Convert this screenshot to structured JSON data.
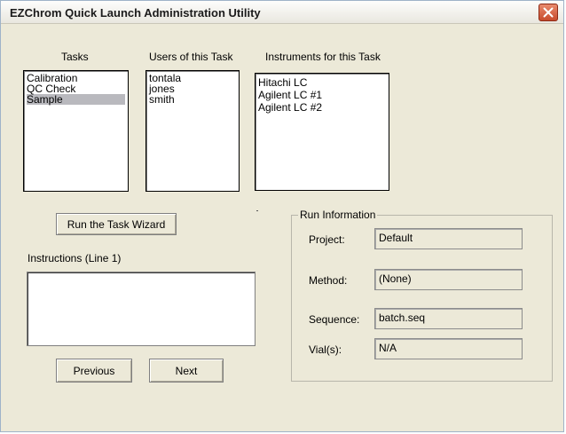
{
  "window": {
    "title": "EZChrom Quick Launch Administration Utility"
  },
  "tasks": {
    "header": "Tasks",
    "items": [
      "Calibration",
      "QC Check",
      "Sample"
    ],
    "selected_index": 2
  },
  "users": {
    "header": "Users of this Task",
    "items": [
      "tontala",
      "jones",
      "smith"
    ]
  },
  "instruments": {
    "header": "Instruments for this Task",
    "items": [
      "Hitachi LC",
      "Agilent LC #1",
      "Agilent LC #2"
    ]
  },
  "buttons": {
    "run_wizard": "Run the Task Wizard",
    "previous": "Previous",
    "next": "Next"
  },
  "instructions": {
    "label": "Instructions  (Line 1)",
    "value": ""
  },
  "run_info": {
    "legend": "Run Information",
    "project_label": "Project:",
    "project_value": "Default",
    "method_label": "Method:",
    "method_value": "(None)",
    "sequence_label": "Sequence:",
    "sequence_value": "batch.seq",
    "vials_label": "Vial(s):",
    "vials_value": "N/A"
  },
  "colors": {
    "close_button": "#c74b2c",
    "selection": "#b9b9be",
    "dialog_bg": "#ece9d8"
  },
  "icons": {
    "close": "close-icon"
  }
}
